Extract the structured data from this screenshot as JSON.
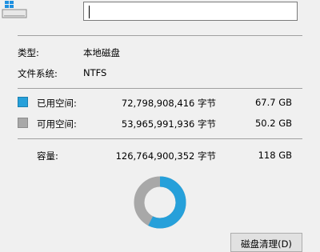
{
  "header": {
    "name_value": ""
  },
  "type": {
    "label": "类型:",
    "value": "本地磁盘"
  },
  "filesystem": {
    "label": "文件系统:",
    "value": "NTFS"
  },
  "used": {
    "label": "已用空间:",
    "bytes": "72,798,908,416 字节",
    "gb": "67.7 GB",
    "color": "#26a0da"
  },
  "free": {
    "label": "可用空间:",
    "bytes": "53,965,991,936 字节",
    "gb": "50.2 GB",
    "color": "#a8a8a8"
  },
  "capacity": {
    "label": "容量:",
    "bytes": "126,764,900,352 字节",
    "gb": "118 GB"
  },
  "usage": {
    "used_fraction": 0.5743
  },
  "actions": {
    "cleanup_label": "磁盘清理(D)"
  },
  "icons": {
    "drive": "drive-icon"
  }
}
